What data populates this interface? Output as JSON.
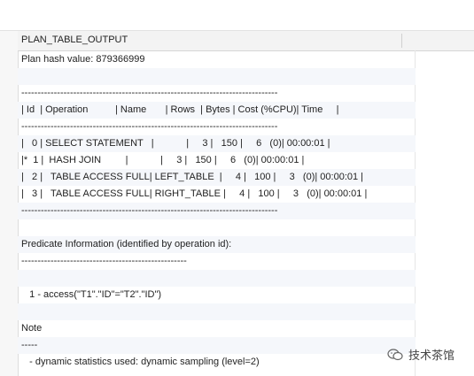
{
  "header": {
    "column_title": "PLAN_TABLE_OUTPUT"
  },
  "output_lines": [
    "Plan hash value: 879366999",
    "",
    "-------------------------------------------------------------------------------",
    "| Id  | Operation          | Name       | Rows  | Bytes | Cost (%CPU)| Time     |",
    "-------------------------------------------------------------------------------",
    "|   0 | SELECT STATEMENT   |            |     3 |   150 |     6   (0)| 00:00:01 |",
    "|*  1 |  HASH JOIN         |            |     3 |   150 |     6   (0)| 00:00:01 |",
    "|   2 |   TABLE ACCESS FULL| LEFT_TABLE  |     4 |   100 |     3   (0)| 00:00:01 |",
    "|   3 |   TABLE ACCESS FULL| RIGHT_TABLE |     4 |   100 |     3   (0)| 00:00:01 |",
    "-------------------------------------------------------------------------------",
    "",
    "Predicate Information (identified by operation id):",
    "---------------------------------------------------",
    "",
    "   1 - access(\"T1\".\"ID\"=\"T2\".\"ID\")",
    "",
    "Note",
    "-----",
    "   - dynamic statistics used: dynamic sampling (level=2)"
  ],
  "watermark": {
    "text": "技术茶馆",
    "icon": "wechat-icon"
  }
}
